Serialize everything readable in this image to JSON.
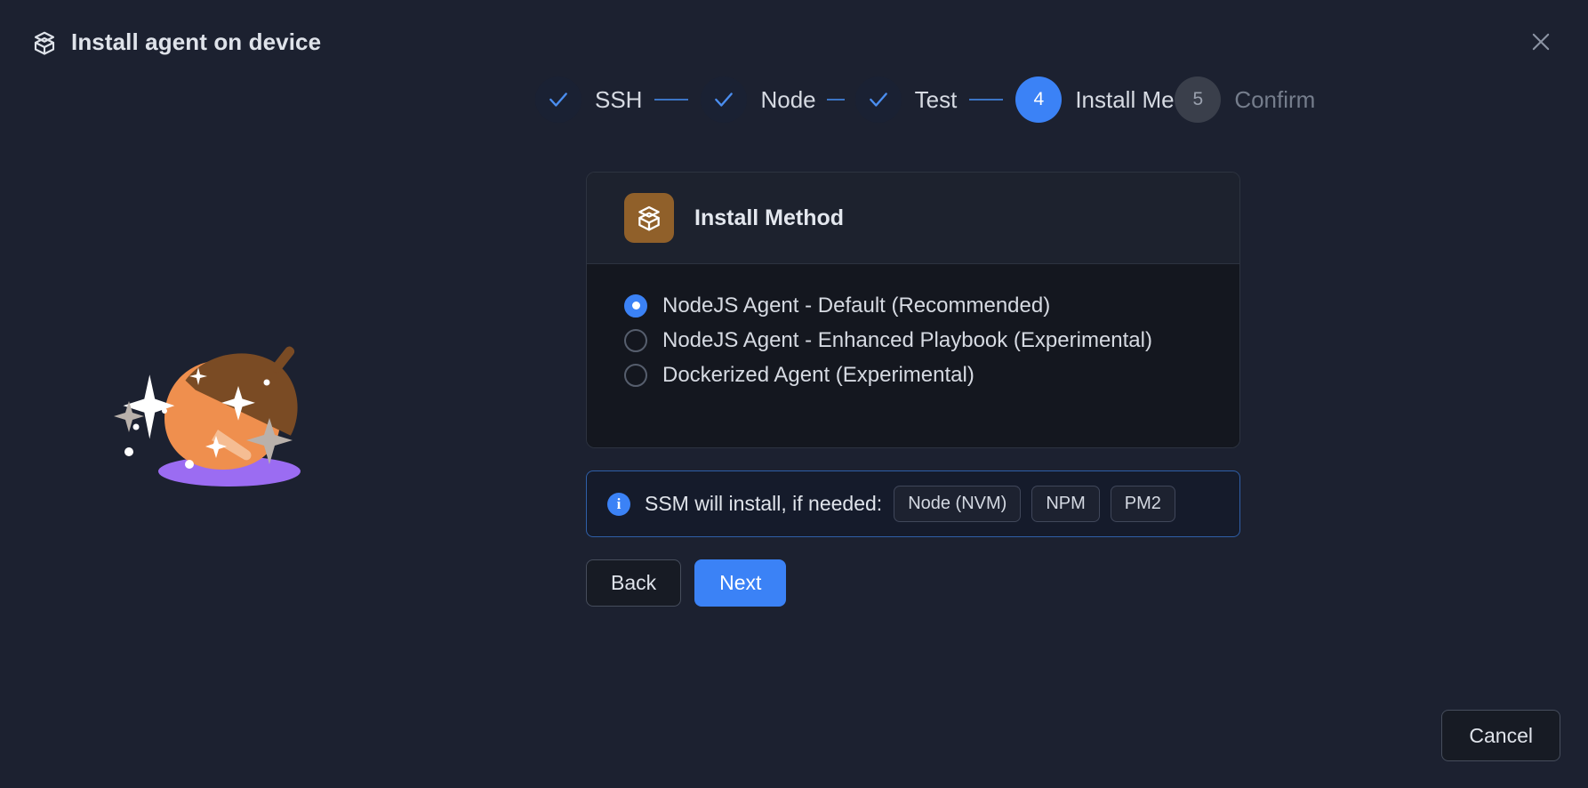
{
  "window": {
    "title": "Install agent on device",
    "title_icon": "open-box-icon",
    "close_icon": "close-icon"
  },
  "stepper": {
    "steps": [
      {
        "number": "1",
        "label": "SSH",
        "state": "done",
        "marker": "✓"
      },
      {
        "number": "2",
        "label": "Node",
        "state": "done",
        "marker": "✓"
      },
      {
        "number": "3",
        "label": "Test",
        "state": "done",
        "marker": "✓"
      },
      {
        "number": "4",
        "label": "Install Method",
        "state": "active",
        "marker": "4"
      },
      {
        "number": "5",
        "label": "Confirm",
        "state": "todo",
        "marker": "5"
      }
    ],
    "active_color": "#3b82f6",
    "done_check_color": "#4b8ef0",
    "todo_circle_color": "#3a3f4b",
    "connector_color": "#3b74c4"
  },
  "illustration": {
    "name": "acorn-illustration",
    "body_color": "#ef8f4e",
    "cap_color": "#7a4b24",
    "shadow_color": "#9b6cf2",
    "sparkle_color": "#ffffff"
  },
  "card": {
    "icon": "open-box-icon",
    "icon_bg": "#90602a",
    "title": "Install Method",
    "options": [
      {
        "label": "NodeJS Agent - Default (Recommended)",
        "selected": true
      },
      {
        "label": "NodeJS Agent - Enhanced Playbook (Experimental)",
        "selected": false
      },
      {
        "label": "Dockerized Agent (Experimental)",
        "selected": false
      }
    ]
  },
  "info_banner": {
    "icon": "info-icon",
    "text": "SSM will install, if needed:",
    "chips": [
      "Node (NVM)",
      "NPM",
      "PM2"
    ],
    "border_color": "#2f5fa8"
  },
  "footer": {
    "back_label": "Back",
    "next_label": "Next",
    "cancel_label": "Cancel"
  }
}
